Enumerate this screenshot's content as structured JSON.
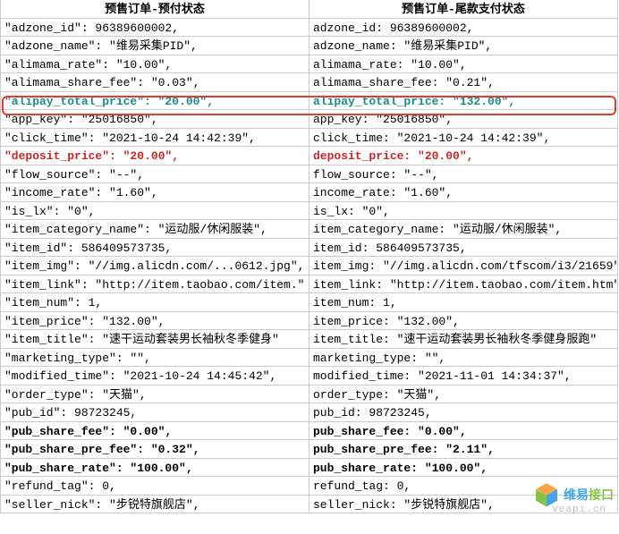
{
  "headers": {
    "left": "预售订单-预付状态",
    "right": "预售订单-尾款支付状态"
  },
  "rows": [
    {
      "key": "adzone_id",
      "left": "96389600002",
      "right": "96389600002",
      "type": "num"
    },
    {
      "key": "adzone_name",
      "left": "维易采集PID",
      "right": "维易采集PID",
      "type": "str"
    },
    {
      "key": "alimama_rate",
      "left": "10.00",
      "right": "10.00",
      "type": "str"
    },
    {
      "key": "alimama_share_fee",
      "left": "0.03",
      "right": "0.21",
      "type": "str"
    },
    {
      "key": "alipay_total_price",
      "left": "20.00",
      "right": "132.00",
      "type": "str",
      "styleLeft": "highlight-teal",
      "styleRight": "highlight-teal",
      "redbox": true
    },
    {
      "key": "app_key",
      "left": "25016850",
      "right": "25016850",
      "type": "str"
    },
    {
      "key": "click_time",
      "left": "2021-10-24 14:42:39",
      "right": "2021-10-24 14:42:39",
      "type": "str"
    },
    {
      "key": "deposit_price",
      "left": "20.00",
      "right": "20.00",
      "type": "str",
      "styleLeft": "highlight-red",
      "styleRight": "highlight-red"
    },
    {
      "key": "flow_source",
      "left": "--",
      "right": "--",
      "type": "str"
    },
    {
      "key": "income_rate",
      "left": "1.60",
      "right": "1.60",
      "type": "str"
    },
    {
      "key": "is_lx",
      "left": "0",
      "right": "0",
      "type": "str"
    },
    {
      "key": "item_category_name",
      "left": "运动服/休闲服装",
      "right": "运动服/休闲服装",
      "type": "str"
    },
    {
      "key": "item_id",
      "left": "586409573735",
      "right": "586409573735",
      "type": "num"
    },
    {
      "key": "item_img",
      "left": "//img.alicdn.com/...0612.jpg",
      "right": "//img.alicdn.com/tfscom/i3/21659",
      "type": "str",
      "truncRight": true
    },
    {
      "key": "item_link",
      "left": "http://item.taobao.com/item.",
      "right": "http://item.taobao.com/item.htm",
      "type": "str",
      "truncLeft": true,
      "truncRight": true
    },
    {
      "key": "item_num",
      "left": "1",
      "right": "1",
      "type": "num"
    },
    {
      "key": "item_price",
      "left": "132.00",
      "right": "132.00",
      "type": "str"
    },
    {
      "key": "item_title",
      "left": "速干运动套装男长袖秋冬季健身",
      "right": "速干运动套装男长袖秋冬季健身服跑",
      "type": "str",
      "truncLeft": true,
      "truncRight": true
    },
    {
      "key": "marketing_type",
      "left": "",
      "right": "",
      "type": "str"
    },
    {
      "key": "modified_time",
      "left": "2021-10-24 14:45:42",
      "right": "2021-11-01 14:34:37",
      "type": "str"
    },
    {
      "key": "order_type",
      "left": "天猫",
      "right": "天猫",
      "type": "str"
    },
    {
      "key": "pub_id",
      "left": "98723245",
      "right": "98723245",
      "type": "num"
    },
    {
      "key": "pub_share_fee",
      "left": "0.00",
      "right": "0.00",
      "type": "str",
      "styleLeft": "highlight-bold",
      "styleRight": "highlight-bold"
    },
    {
      "key": "pub_share_pre_fee",
      "left": "0.32",
      "right": "2.11",
      "type": "str",
      "styleLeft": "highlight-bold",
      "styleRight": "highlight-bold"
    },
    {
      "key": "pub_share_rate",
      "left": "100.00",
      "right": "100.00",
      "type": "str",
      "styleLeft": "highlight-bold",
      "styleRight": "highlight-bold"
    },
    {
      "key": "refund_tag",
      "left": "0",
      "right": "0",
      "type": "num"
    },
    {
      "key": "seller_nick",
      "left": "步锐特旗舰店",
      "right": "步锐特旗舰店",
      "type": "str"
    }
  ],
  "watermark": {
    "brand1": "维易",
    "brand2": "接口",
    "domain": "veapi.cn"
  }
}
